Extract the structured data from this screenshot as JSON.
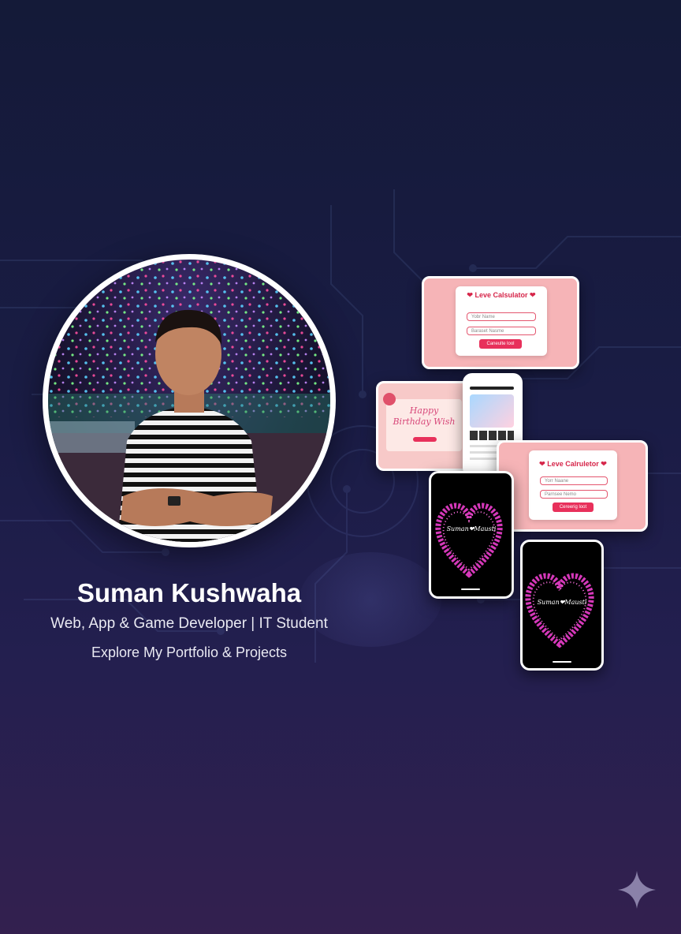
{
  "profile": {
    "name": "Suman Kushwaha",
    "role": "Web, App & Game Developer | IT Student",
    "cta": "Explore My Portfolio & Projects"
  },
  "projects": {
    "love_calc_1": {
      "title": "Leve Calsulator",
      "field1": "Yobr Name",
      "field2": "Baraset Nasme",
      "button": "Caneulte lool"
    },
    "love_calc_2": {
      "title": "Leve Calruletor",
      "field1": "Yorr Naane",
      "field2": "Parnsee Nemo",
      "button": "Cereerig loot"
    },
    "birthday": {
      "title_line1": "Happy",
      "title_line2": "Birthday Wish"
    },
    "heart_1": {
      "label": "Suman❤Mausti"
    },
    "heart_2": {
      "label": "Suman❤Mausti"
    }
  },
  "colors": {
    "accent_pink": "#e8305b",
    "card_pink": "#f6b4b7",
    "heart_magenta": "#e23bc4",
    "background_top": "#141a38",
    "background_bottom": "#33204f"
  },
  "icons": {
    "sparkle": "sparkle-icon",
    "heart": "heart-icon"
  }
}
